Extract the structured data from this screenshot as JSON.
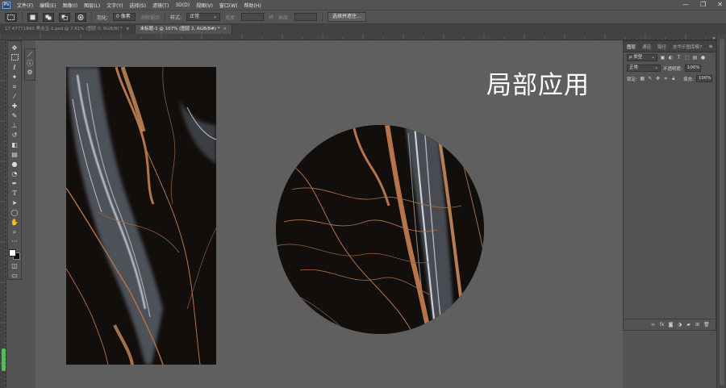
{
  "menu": {
    "logo": "Ps",
    "items": [
      "文件(F)",
      "编辑(E)",
      "图像(I)",
      "图层(L)",
      "文字(Y)",
      "选择(S)",
      "滤镜(T)",
      "3D(D)",
      "视图(V)",
      "窗口(W)",
      "帮助(H)"
    ],
    "minimize": "—",
    "restore": "❐",
    "close": "✕"
  },
  "options": {
    "feather_label": "羽化:",
    "feather_value": "0 像素",
    "antialias_label": "消除锯齿",
    "style_label": "样式:",
    "style_value": "正常",
    "width_label": "宽度:",
    "height_label": "高度:",
    "select_mask_button": "选择并遮住..."
  },
  "tabs": [
    {
      "label": "17 47771843 黑沧玉-1.psd @ 7.61% (图层 0, RGB/8) *",
      "close": "×"
    },
    {
      "label": "未标题-1 @ 107% (图层 2, RGB/8#) *",
      "close": "×"
    }
  ],
  "canvas": {
    "title_text": "局部应用",
    "colors": {
      "canvas_bg": "#5f5f5f",
      "stone_base": "#120e0c",
      "vein_copper": "#b6744a",
      "vein_silver": "#c9d3df"
    }
  },
  "layers_panel": {
    "tabs": [
      "图层",
      "通道",
      "路径",
      "皮华乐图库模7"
    ],
    "active_tab": "图层",
    "filter_label": "ρ 类型",
    "blend_mode": "正常",
    "opacity_label": "不透明度:",
    "opacity_value": "100%",
    "lock_label": "锁定:",
    "fill_label": "填充:",
    "fill_value": "100%"
  }
}
